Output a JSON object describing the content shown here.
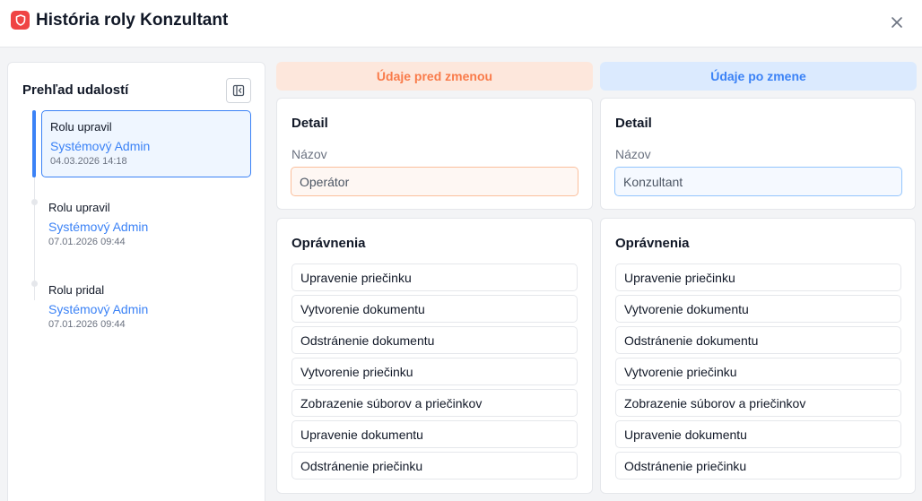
{
  "window": {
    "title": "História roly Konzultant",
    "app_icon": "shield-icon",
    "close_icon": "close-icon"
  },
  "sidebar": {
    "title": "Prehľad udalostí",
    "collapse_icon": "collapse-sidebar-icon",
    "events": [
      {
        "action": "Rolu upravil",
        "user": "Systémový Admin",
        "time": "04.03.2026 14:18"
      },
      {
        "action": "Rolu upravil",
        "user": "Systémový Admin",
        "time": "07.01.2026 09:44"
      },
      {
        "action": "Rolu pridal",
        "user": "Systémový Admin",
        "time": "07.01.2026 09:44"
      }
    ]
  },
  "before": {
    "header": "Údaje pred zmenou",
    "detail": {
      "title": "Detail",
      "name_label": "Názov",
      "name_value": "Operátor"
    },
    "permissions": {
      "title": "Oprávnenia",
      "items": [
        "Upravenie priečinku",
        "Vytvorenie dokumentu",
        "Odstránenie dokumentu",
        "Vytvorenie priečinku",
        "Zobrazenie súborov a priečinkov",
        "Upravenie dokumentu",
        "Odstránenie priečinku"
      ]
    }
  },
  "after": {
    "header": "Údaje po zmene",
    "detail": {
      "title": "Detail",
      "name_label": "Názov",
      "name_value": "Konzultant"
    },
    "permissions": {
      "title": "Oprávnenia",
      "items": [
        "Upravenie priečinku",
        "Vytvorenie dokumentu",
        "Odstránenie dokumentu",
        "Vytvorenie priečinku",
        "Zobrazenie súborov a priečinkov",
        "Upravenie dokumentu",
        "Odstránenie priečinku"
      ]
    }
  },
  "colors": {
    "accent_blue": "#3b82f6",
    "accent_orange": "#f97b4a",
    "app_icon_red": "#ef4444"
  }
}
